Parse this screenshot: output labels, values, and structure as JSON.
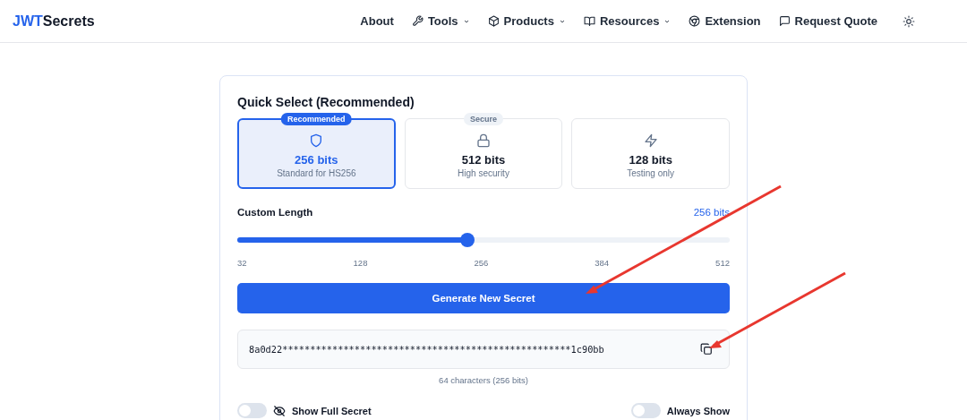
{
  "header": {
    "logo_accent": "JWT",
    "logo_rest": "Secrets",
    "nav": [
      {
        "label": "About",
        "dropdown": false
      },
      {
        "label": "Tools",
        "dropdown": true
      },
      {
        "label": "Products",
        "dropdown": true
      },
      {
        "label": "Resources",
        "dropdown": true
      },
      {
        "label": "Extension",
        "dropdown": false
      },
      {
        "label": "Request Quote",
        "dropdown": false
      }
    ]
  },
  "quick_select": {
    "title": "Quick Select (Recommended)",
    "options": [
      {
        "badge": "Recommended",
        "bits": "256 bits",
        "description": "Standard for HS256",
        "selected": true
      },
      {
        "badge": "Secure",
        "bits": "512 bits",
        "description": "High security",
        "selected": false
      },
      {
        "bits": "128 bits",
        "description": "Testing only",
        "selected": false
      }
    ]
  },
  "custom_length": {
    "label": "Custom Length",
    "value": "256 bits",
    "level": 0.467,
    "ticks": [
      "32",
      "128",
      "256",
      "384",
      "512"
    ]
  },
  "generate_button": "Generate New Secret",
  "secret": {
    "value": "8a0d22****************************************************1c90bb",
    "info": "64 characters (256 bits)"
  },
  "toggles": [
    {
      "label": "Show Full Secret",
      "on": false
    },
    {
      "label": "Always Show",
      "on": false
    }
  ]
}
